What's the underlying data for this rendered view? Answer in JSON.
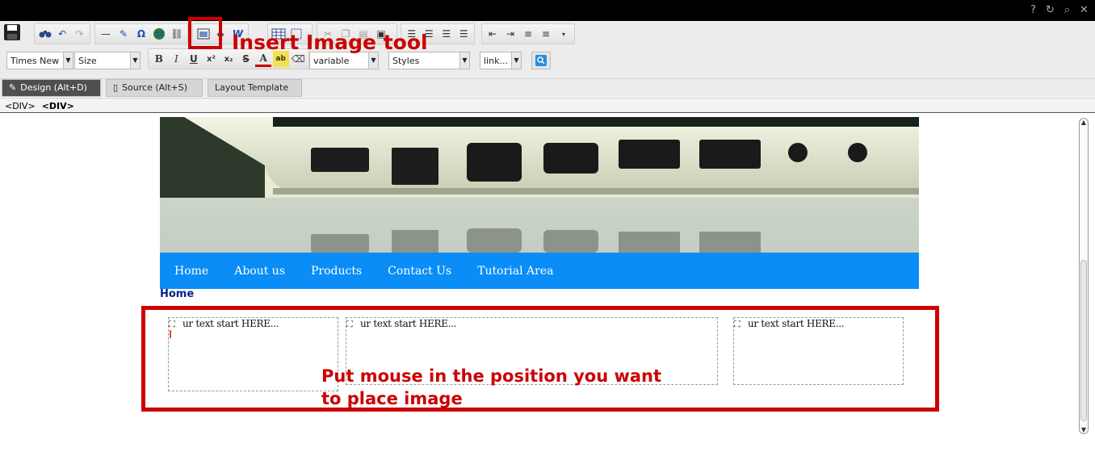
{
  "toolbar": {
    "font_family": "Times New",
    "font_size": "Size",
    "paragraph": "variable",
    "styles": "Styles",
    "links": "link..."
  },
  "tabs": [
    {
      "label": "Design (Alt+D)",
      "active": true
    },
    {
      "label": "Source (Alt+S)",
      "active": false
    },
    {
      "label": "Layout Template",
      "active": false
    }
  ],
  "path": {
    "first": "<DIV>",
    "second": "<DIV>"
  },
  "site": {
    "nav": [
      "Home",
      "About us",
      "Products",
      "Contact Us",
      "Tutorial Area"
    ],
    "breadcrumb": "Home",
    "columns": [
      {
        "text": "ur text start HERE..."
      },
      {
        "text": "ur text start HERE..."
      },
      {
        "text": "ur text start HERE..."
      }
    ]
  },
  "annotations": {
    "insert_image": "Insert Image tool",
    "instruction_line1": "Put mouse in the position you want",
    "instruction_line2": "to place image"
  },
  "colors": {
    "annotation_red": "#cc0000",
    "nav_blue": "#0a8df7",
    "active_tab": "#4f4f4f"
  }
}
